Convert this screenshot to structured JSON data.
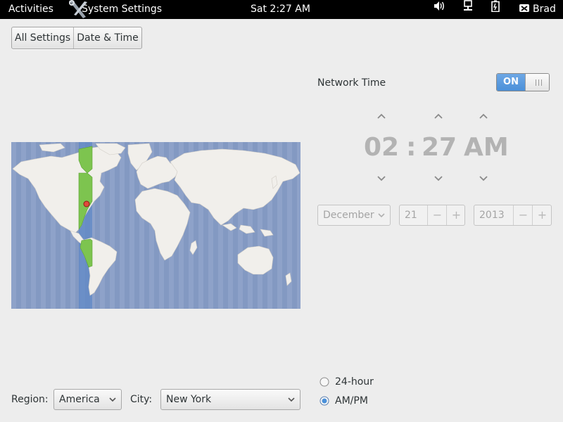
{
  "topbar": {
    "activities": "Activities",
    "app_name": "System Settings",
    "clock": "Sat  2:27 AM",
    "user": "Brad",
    "icons": [
      "volume-icon",
      "network-icon",
      "battery-icon",
      "user-icon"
    ]
  },
  "breadcrumb": {
    "items": [
      {
        "label": "All Settings"
      },
      {
        "label": "Date & Time"
      }
    ]
  },
  "map": {
    "selected_city": "New York",
    "highlight_color": "#78c64b",
    "ocean_color": "#8da1c8"
  },
  "network_time": {
    "label": "Network Time",
    "switch_state": "ON",
    "accent": "#4a90d9"
  },
  "time": {
    "hour": "02",
    "separator": ":",
    "minute": "27",
    "ampm": "AM"
  },
  "date": {
    "month": "December",
    "day": "21",
    "year": "2013",
    "minus": "−",
    "plus": "+"
  },
  "location": {
    "region_label": "Region:",
    "region_value": "America",
    "city_label": "City:",
    "city_value": "New York"
  },
  "time_format": {
    "options": [
      {
        "label": "24-hour",
        "selected": false
      },
      {
        "label": "AM/PM",
        "selected": true
      }
    ]
  }
}
